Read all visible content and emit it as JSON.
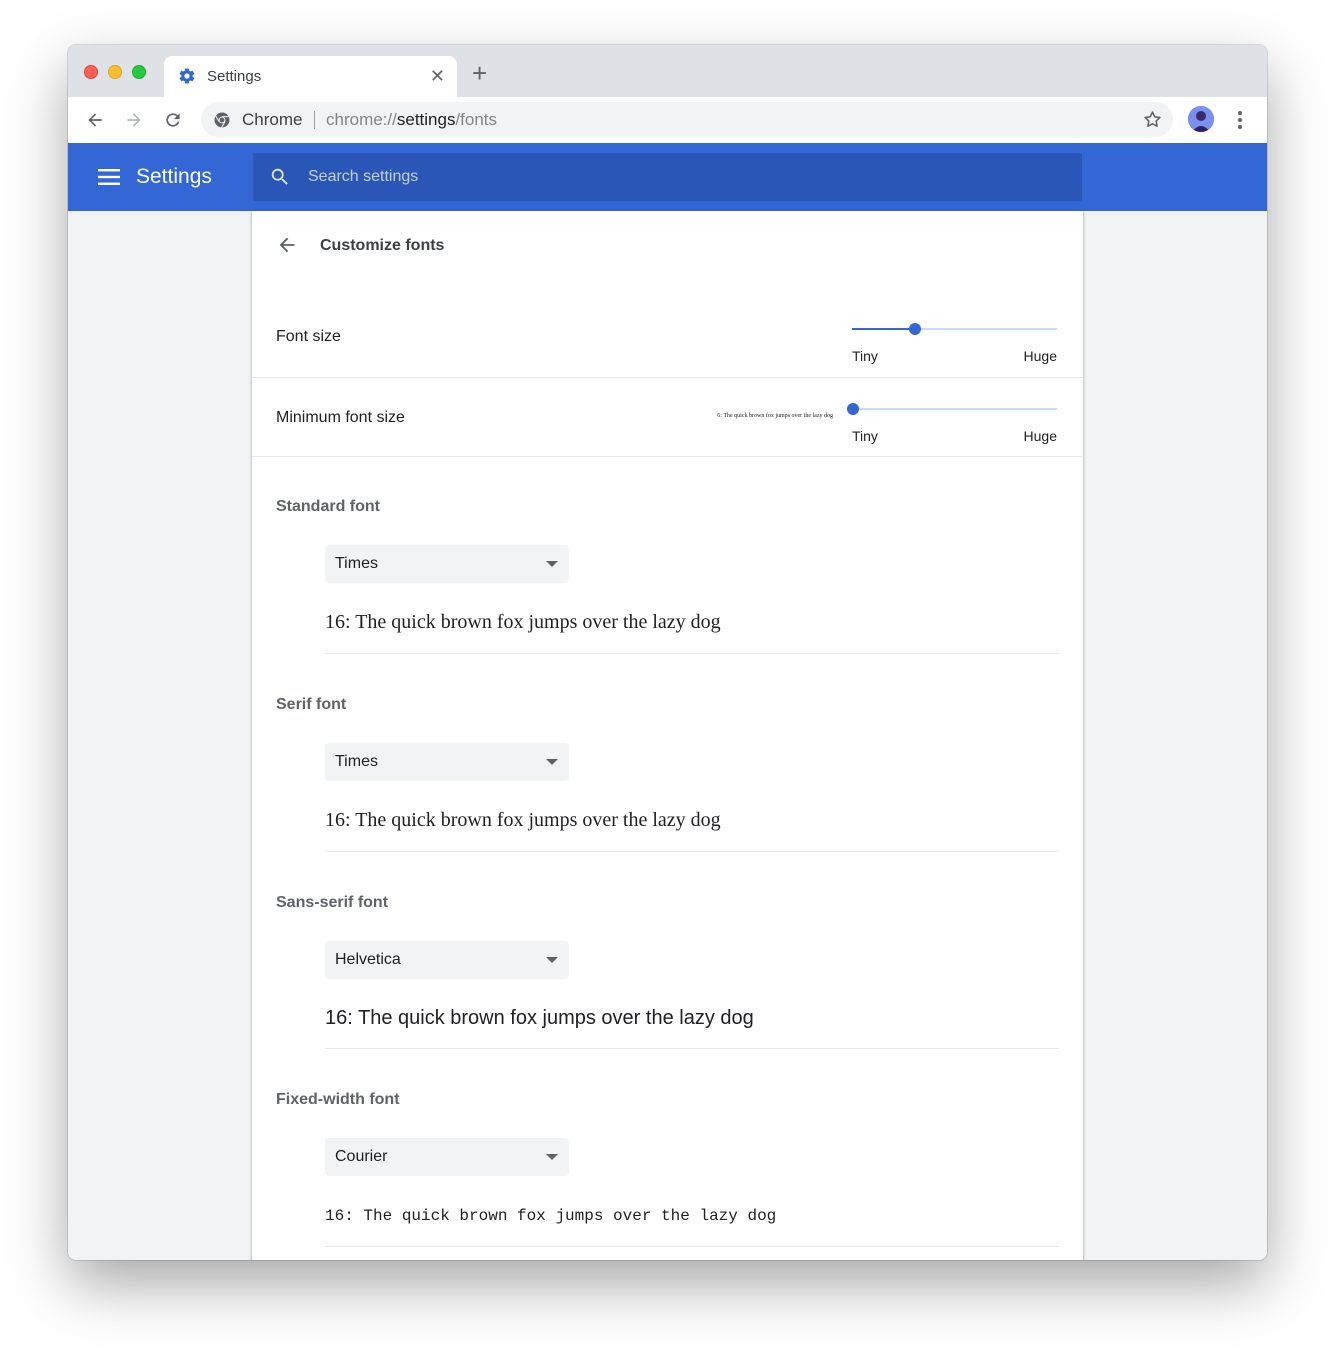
{
  "browser": {
    "tab_title": "Settings",
    "tab_close": "✕",
    "new_tab": "+",
    "omnibox_chrome_label": "Chrome",
    "url_scheme": "chrome://",
    "url_host": "settings",
    "url_path": "/fonts"
  },
  "header": {
    "title": "Settings",
    "search_placeholder": "Search settings"
  },
  "subpage": {
    "title": "Customize fonts"
  },
  "font_size": {
    "label": "Font size",
    "min_label": "Tiny",
    "max_label": "Huge",
    "value_fraction": 0.3
  },
  "minimum_font_size": {
    "label": "Minimum font size",
    "sample": "6: The quick brown fox jumps over the lazy dog",
    "min_label": "Tiny",
    "max_label": "Huge",
    "value_fraction": 0.0
  },
  "fonts": [
    {
      "title": "Standard font",
      "selected": "Times",
      "sample": "16: The quick brown fox jumps over the lazy dog"
    },
    {
      "title": "Serif font",
      "selected": "Times",
      "sample": "16: The quick brown fox jumps over the lazy dog"
    },
    {
      "title": "Sans-serif font",
      "selected": "Helvetica",
      "sample": "16: The quick brown fox jumps over the lazy dog"
    },
    {
      "title": "Fixed-width font",
      "selected": "Courier",
      "sample": "16: The quick brown fox jumps over the lazy dog"
    }
  ],
  "colors": {
    "accent": "#3367d6",
    "search_bg": "#2a56b8"
  }
}
